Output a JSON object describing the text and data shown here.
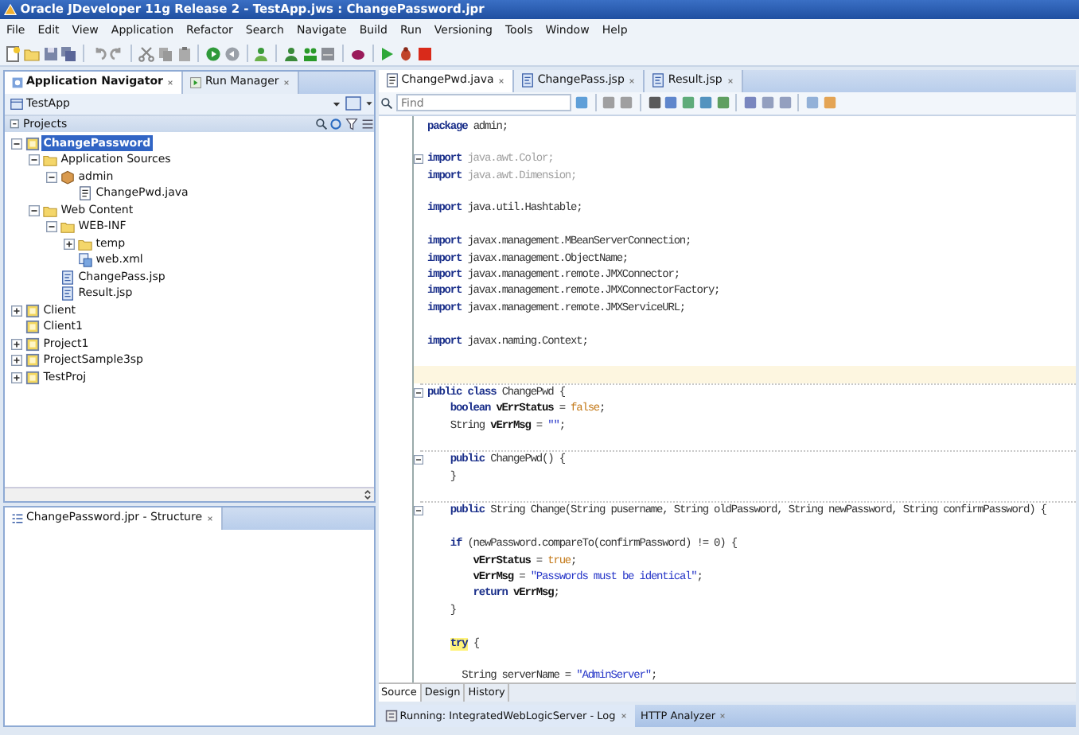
{
  "window": {
    "title": "Oracle JDeveloper 11g Release 2 - TestApp.jws : ChangePassword.jpr"
  },
  "menu": [
    "File",
    "Edit",
    "View",
    "Application",
    "Refactor",
    "Search",
    "Navigate",
    "Build",
    "Run",
    "Versioning",
    "Tools",
    "Window",
    "Help"
  ],
  "navigator": {
    "tabs": [
      {
        "label": "Application Navigator",
        "selected": true
      },
      {
        "label": "Run Manager",
        "selected": false
      }
    ],
    "application": "TestApp",
    "section": "Projects",
    "tree": [
      {
        "label": "ChangePassword",
        "kind": "project",
        "expanded": true,
        "selected": true,
        "children": [
          {
            "label": "Application Sources",
            "kind": "folder",
            "expanded": true,
            "selected": false,
            "children": [
              {
                "label": "admin",
                "kind": "package",
                "expanded": true,
                "selected": false,
                "children": [
                  {
                    "label": "ChangePwd.java",
                    "kind": "java",
                    "selected": false
                  }
                ]
              }
            ]
          },
          {
            "label": "Web Content",
            "kind": "folder",
            "expanded": true,
            "selected": false,
            "children": [
              {
                "label": "WEB-INF",
                "kind": "folder",
                "expanded": true,
                "selected": false,
                "children": [
                  {
                    "label": "temp",
                    "kind": "folder",
                    "expanded": false,
                    "selected": false
                  },
                  {
                    "label": "web.xml",
                    "kind": "xml",
                    "selected": false
                  }
                ]
              },
              {
                "label": "ChangePass.jsp",
                "kind": "jsp",
                "selected": false
              },
              {
                "label": "Result.jsp",
                "kind": "jsp",
                "selected": false
              }
            ]
          }
        ]
      },
      {
        "label": "Client",
        "kind": "project",
        "expanded": false,
        "selected": false
      },
      {
        "label": "Client1",
        "kind": "project",
        "selected": false
      },
      {
        "label": "Project1",
        "kind": "project",
        "expanded": false,
        "selected": false
      },
      {
        "label": "ProjectSample3sp",
        "kind": "project",
        "expanded": false,
        "selected": false
      },
      {
        "label": "TestProj",
        "kind": "project",
        "expanded": false,
        "selected": false
      }
    ]
  },
  "structure": {
    "tab": "ChangePassword.jpr - Structure"
  },
  "editor": {
    "tabs": [
      {
        "label": "ChangePwd.java",
        "kind": "java",
        "selected": true
      },
      {
        "label": "ChangePass.jsp",
        "kind": "jsp",
        "selected": false
      },
      {
        "label": "Result.jsp",
        "kind": "jsp",
        "selected": false
      }
    ],
    "find": {
      "placeholder": "Find"
    },
    "blocks": [
      {
        "lines": [
          {
            "segments": [
              {
                "text": "package",
                "kind": "keyword"
              },
              {
                "text": " admin;",
                "kind": "plain"
              }
            ]
          }
        ]
      },
      {
        "lines": [
          {
            "fold": true,
            "segments": [
              {
                "text": "import",
                "kind": "keyword"
              },
              {
                "text": " java.awt.Color;",
                "kind": "unused"
              }
            ]
          },
          {
            "segments": [
              {
                "text": "import",
                "kind": "keyword"
              },
              {
                "text": " java.awt.Dimension;",
                "kind": "unused"
              }
            ]
          }
        ]
      },
      {
        "lines": [
          {
            "segments": [
              {
                "text": "import",
                "kind": "keyword"
              },
              {
                "text": " java.util.Hashtable;",
                "kind": "plain"
              }
            ]
          }
        ]
      },
      {
        "lines": [
          {
            "segments": [
              {
                "text": "import",
                "kind": "keyword"
              },
              {
                "text": " javax.management.MBeanServerConnection;",
                "kind": "plain"
              }
            ]
          },
          {
            "segments": [
              {
                "text": "import",
                "kind": "keyword"
              },
              {
                "text": " javax.management.ObjectName;",
                "kind": "plain"
              }
            ]
          },
          {
            "segments": [
              {
                "text": "import",
                "kind": "keyword"
              },
              {
                "text": " javax.management.remote.JMXConnector;",
                "kind": "plain"
              }
            ]
          },
          {
            "segments": [
              {
                "text": "import",
                "kind": "keyword"
              },
              {
                "text": " javax.management.remote.JMXConnectorFactory;",
                "kind": "plain"
              }
            ]
          },
          {
            "segments": [
              {
                "text": "import",
                "kind": "keyword"
              },
              {
                "text": " javax.management.remote.JMXServiceURL;",
                "kind": "plain"
              }
            ]
          }
        ]
      },
      {
        "lines": [
          {
            "segments": [
              {
                "text": "import",
                "kind": "keyword"
              },
              {
                "text": " javax.naming.Context;",
                "kind": "plain"
              }
            ]
          }
        ]
      },
      {
        "lines": [
          {
            "current": true
          },
          {
            "fold": true,
            "divider": true,
            "segments": [
              {
                "text": "public class",
                "kind": "keyword"
              },
              {
                "text": " ChangePwd {",
                "kind": "plain"
              }
            ]
          },
          {
            "segments": [
              {
                "text": "    boolean",
                "kind": "keyword"
              },
              {
                "text": " vErrStatus",
                "kind": "field"
              },
              {
                "text": " = ",
                "kind": "plain"
              },
              {
                "text": "false",
                "kind": "literal"
              },
              {
                "text": ";",
                "kind": "plain"
              }
            ]
          },
          {
            "segments": [
              {
                "text": "    String",
                "kind": "plain"
              },
              {
                "text": " vErrMsg",
                "kind": "field"
              },
              {
                "text": " = ",
                "kind": "plain"
              },
              {
                "text": "\"\"",
                "kind": "string"
              },
              {
                "text": ";",
                "kind": "plain"
              }
            ]
          }
        ]
      },
      {
        "lines": [
          {
            "fold": true,
            "divider": true,
            "segments": [
              {
                "text": "    public",
                "kind": "keyword"
              },
              {
                "text": " ChangePwd() {",
                "kind": "plain"
              }
            ]
          },
          {
            "segments": [
              {
                "text": "    }",
                "kind": "plain"
              }
            ]
          }
        ]
      },
      {
        "lines": [
          {
            "fold": true,
            "divider": true,
            "segments": [
              {
                "text": "    public",
                "kind": "keyword"
              },
              {
                "text": " String Change(String pusername, String oldPassword, String newPassword, String confirmPassword) {",
                "kind": "plain"
              }
            ]
          }
        ]
      },
      {
        "lines": [
          {
            "segments": [
              {
                "text": "    if",
                "kind": "keyword"
              },
              {
                "text": " (newPassword.compareTo(confirmPassword) != 0) {",
                "kind": "plain"
              }
            ]
          },
          {
            "segments": [
              {
                "text": "        vErrStatus",
                "kind": "field"
              },
              {
                "text": " = ",
                "kind": "plain"
              },
              {
                "text": "true",
                "kind": "literal"
              },
              {
                "text": ";",
                "kind": "plain"
              }
            ]
          },
          {
            "segments": [
              {
                "text": "        vErrMsg",
                "kind": "field"
              },
              {
                "text": " = ",
                "kind": "plain"
              },
              {
                "text": "\"Passwords must be identical\"",
                "kind": "string"
              },
              {
                "text": ";",
                "kind": "plain"
              }
            ]
          },
          {
            "segments": [
              {
                "text": "        return",
                "kind": "keyword"
              },
              {
                "text": " vErrMsg",
                "kind": "field"
              },
              {
                "text": ";",
                "kind": "plain"
              }
            ]
          },
          {
            "segments": [
              {
                "text": "    }",
                "kind": "plain"
              }
            ]
          }
        ]
      },
      {
        "lines": [
          {
            "segments": [
              {
                "text": "    try",
                "kind": "matched"
              },
              {
                "text": " {",
                "kind": "plain"
              }
            ]
          }
        ]
      },
      {
        "lines": [
          {
            "segments": [
              {
                "text": "      String serverName = ",
                "kind": "plain"
              },
              {
                "text": "\"AdminServer\"",
                "kind": "string"
              },
              {
                "text": ";",
                "kind": "plain"
              }
            ]
          }
        ]
      }
    ],
    "view_tabs": [
      {
        "label": "Source",
        "selected": true
      },
      {
        "label": "Design",
        "selected": false
      },
      {
        "label": "History",
        "selected": false
      }
    ]
  },
  "log": {
    "tabs": [
      {
        "label": "Running: IntegratedWebLogicServer - Log",
        "selected": true
      },
      {
        "label": "HTTP Analyzer",
        "selected": false
      }
    ]
  }
}
